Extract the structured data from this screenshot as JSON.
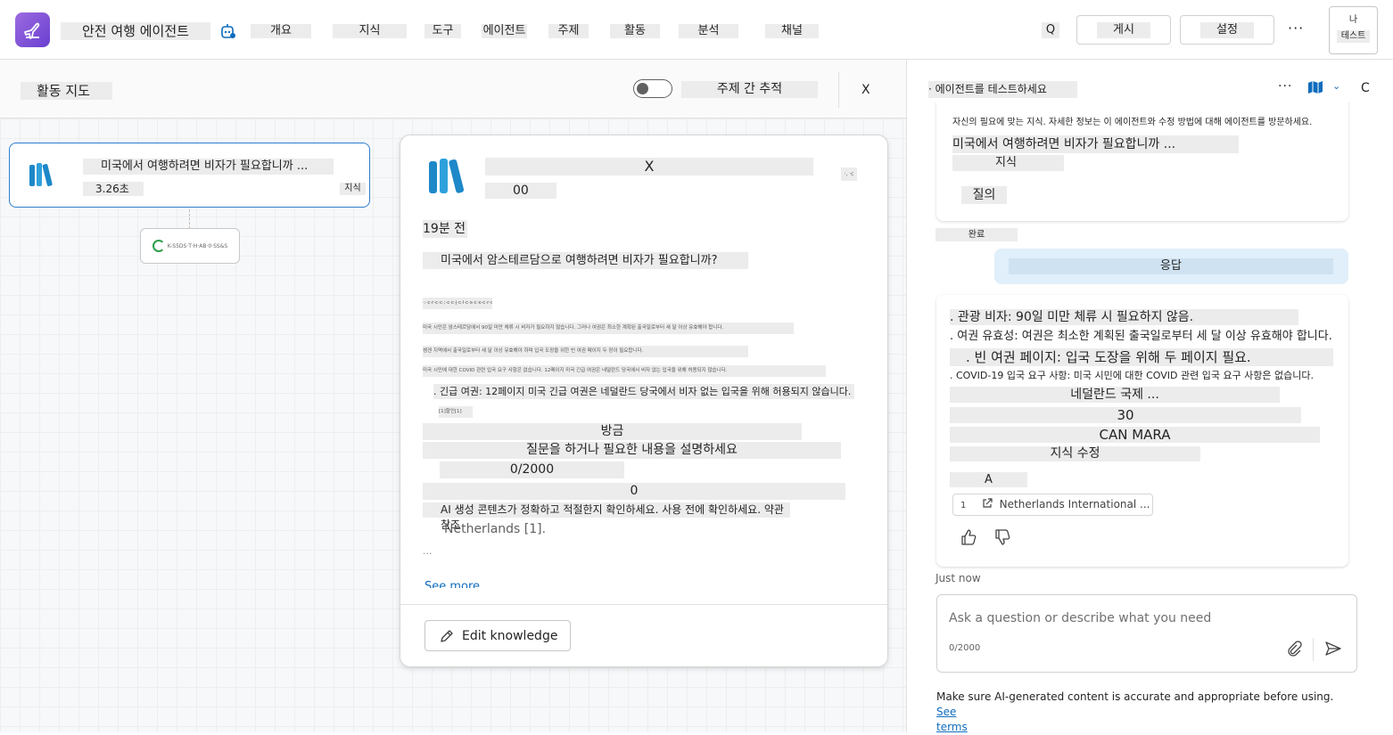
{
  "header": {
    "app_name": "안전 여행 에이전트",
    "nav": [
      "개요",
      "지식",
      "도구",
      "에이전트",
      "주제",
      "활동",
      "분석",
      "채널"
    ],
    "search_label": "Q",
    "publish_label": "게시",
    "settings_label": "설정",
    "more_label": "···",
    "test_label": "테스트",
    "test_icon_label": "나"
  },
  "activity": {
    "title": "활동 지도",
    "trace_label": "주제 간 추적",
    "close_label": "X",
    "node": {
      "question": "미국에서 여행하려면 비자가 필요합니까 ...",
      "time": "3.26초",
      "knowledge": "지식"
    },
    "node2_label": "K-S5DS·T·H·AB·0·SS&S"
  },
  "detail": {
    "title": "X",
    "subtitle": "00",
    "mini": "·, ·c",
    "time": "19분 전",
    "question": "미국에서 암스테르담으로 여행하려면 비자가 필요합니까?",
    "tiny": [
      "·:·c·r·c·c·;·c·c·j·c·l·c·s·c·x·c·r·c·a·i·c·",
      "미국 시민은 암스테르담에서 90일 미만 체류 시 비자가 필요하지 않습니다. 그러나 여권은 최소한 계획된 출국일로부터 세 달 이상 유효해야 합니다.",
      "솅겐 지역에서 출국일로부터 세 달 이상 유효해야 하며 입국 도장을 위한 빈 여권 페이지 두 장이 필요합니다.",
      "미국 시민에 대한 COVID 관련 입국 요구 사항은 없습니다. 12페이지 미국 긴급 여권은 네덜란드 당국에서 비자 없는 입국을 위해 허용되지 않습니다."
    ],
    "para": ". 긴급 여권: 12페이지 미국 긴급 여권은 네덜란드 당국에서 비자 없는 입국을 위해 허용되지 않습니다.",
    "tiny_small": "[1]할인[1]",
    "just_label": "방금",
    "prompt": "질문을 하거나 필요한 내용을 설명하세요",
    "counter": "0/2000",
    "zero": "0",
    "disclaimer": "AI 생성 콘텐츠가 정확하고 적절한지 확인하세요. 사용 전에 확인하세요. 약관 참조",
    "netherlands": "Netherlands [1].",
    "ellipsis": "...",
    "see_more": "See more",
    "edit_label": "Edit knowledge"
  },
  "test": {
    "title": "· 에이전트를 테스트하세요",
    "more": "···",
    "close": "C",
    "msg1": {
      "small": "자신의 필요에 맞는 지식. 자세한 정보는 이 에이전트와 수정 방법에 대해 에이전트를 방문하세요.",
      "question": "미국에서 여행하려면 비자가 필요합니까 ...",
      "knowledge": "지식",
      "query": "질의"
    },
    "done": "완료",
    "reply_label": "응답",
    "resp": {
      "lines": [
        ". 관광 비자: 90일 미만 체류 시 필요하지 않음.",
        ". 여권 유효성: 여권은 최소한 계획된 출국일로부터 세 달 이상 유효해야 합니다.",
        ". 빈 여권 페이지: 입국 도장을 위해 두 페이지 필요.",
        ". COVID-19 입국 요구 사항: 미국 시민에 대한 COVID 관련 입국 요구 사항은 없습니다.",
        "네덜란드 국제 ...",
        "30",
        "CAN MARA",
        "지식 수정",
        "A"
      ],
      "cite_num": "1",
      "cite_text": "Netherlands International ..."
    },
    "just_now": "Just now",
    "input_placeholder": "Ask a question or describe what you need",
    "counter": "0/2000",
    "legal_text": "Make sure AI-generated content is accurate and appropriate before using.",
    "legal_link1": "See",
    "legal_link2": "terms"
  }
}
